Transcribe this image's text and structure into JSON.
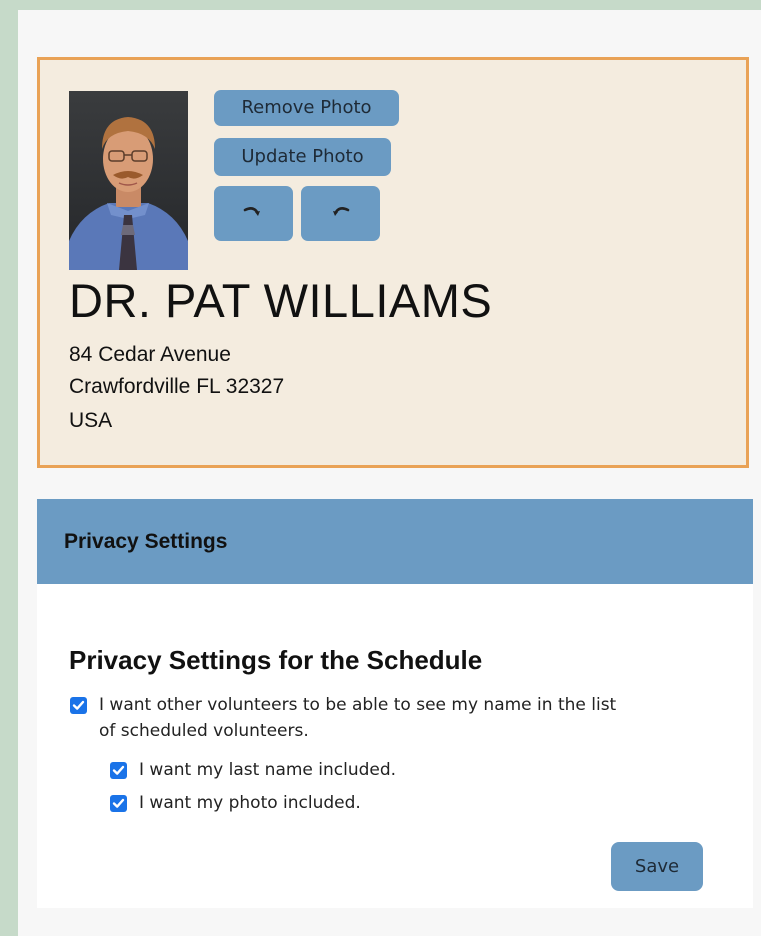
{
  "profile": {
    "remove_photo_label": "Remove Photo",
    "update_photo_label": "Update Photo",
    "name": "DR. PAT WILLIAMS",
    "address_line1": "84 Cedar Avenue",
    "address_line2": "Crawfordville FL 32327",
    "address_line3": "USA"
  },
  "privacy": {
    "header_title": "Privacy Settings",
    "section_heading": "Privacy Settings for the Schedule",
    "options": [
      {
        "label": "I want other volunteers to be able to see my name in the list of scheduled volunteers.",
        "checked": true
      },
      {
        "label": "I want my last name included.",
        "checked": true
      },
      {
        "label": "I want my photo included.",
        "checked": true
      }
    ],
    "save_label": "Save"
  },
  "colors": {
    "page_background": "#c6dac9",
    "card_background": "#f4ecdf",
    "card_border": "#e9a256",
    "button": "#6b9bc3",
    "checkbox": "#1a73e8"
  },
  "icons": {
    "rotate_left": "rotate-clockwise-icon",
    "rotate_right": "rotate-counterclockwise-icon"
  }
}
